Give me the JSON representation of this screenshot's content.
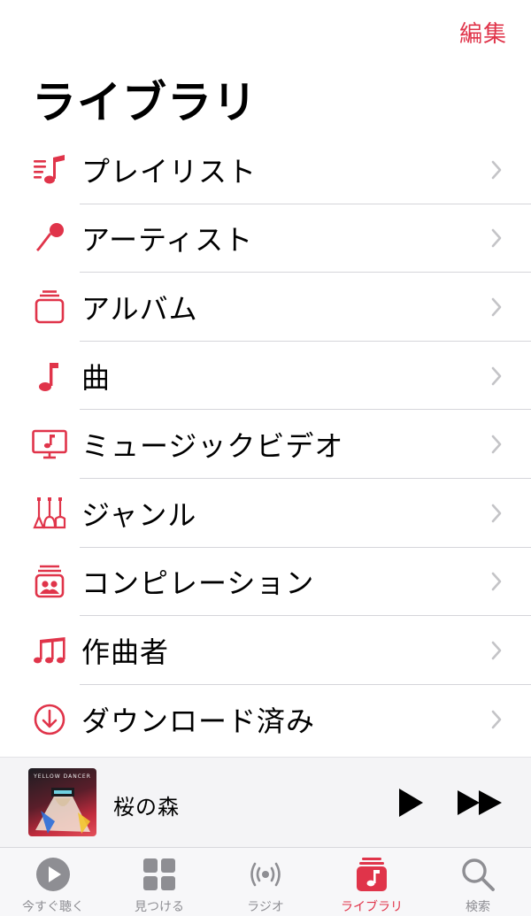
{
  "header": {
    "edit_label": "編集",
    "title": "ライブラリ"
  },
  "library_items": [
    {
      "label": "プレイリスト",
      "icon": "playlist-icon"
    },
    {
      "label": "アーティスト",
      "icon": "microphone-icon"
    },
    {
      "label": "アルバム",
      "icon": "album-icon"
    },
    {
      "label": "曲",
      "icon": "music-note-icon"
    },
    {
      "label": "ミュージックビデオ",
      "icon": "music-video-icon"
    },
    {
      "label": "ジャンル",
      "icon": "guitars-icon"
    },
    {
      "label": "コンピレーション",
      "icon": "compilation-icon"
    },
    {
      "label": "作曲者",
      "icon": "composer-notes-icon"
    },
    {
      "label": "ダウンロード済み",
      "icon": "download-icon"
    }
  ],
  "now_playing": {
    "title": "桜の森",
    "artwork_text": "YELLOW DANCER"
  },
  "tabs": [
    {
      "label": "今すぐ聴く",
      "icon": "play-circle-icon",
      "active": false
    },
    {
      "label": "見つける",
      "icon": "grid-icon",
      "active": false
    },
    {
      "label": "ラジオ",
      "icon": "radio-icon",
      "active": false
    },
    {
      "label": "ライブラリ",
      "icon": "library-icon",
      "active": true
    },
    {
      "label": "検索",
      "icon": "search-icon",
      "active": false
    }
  ],
  "colors": {
    "accent": "#e0344a",
    "inactive": "#8e8e93",
    "separator": "#d5d5da"
  }
}
